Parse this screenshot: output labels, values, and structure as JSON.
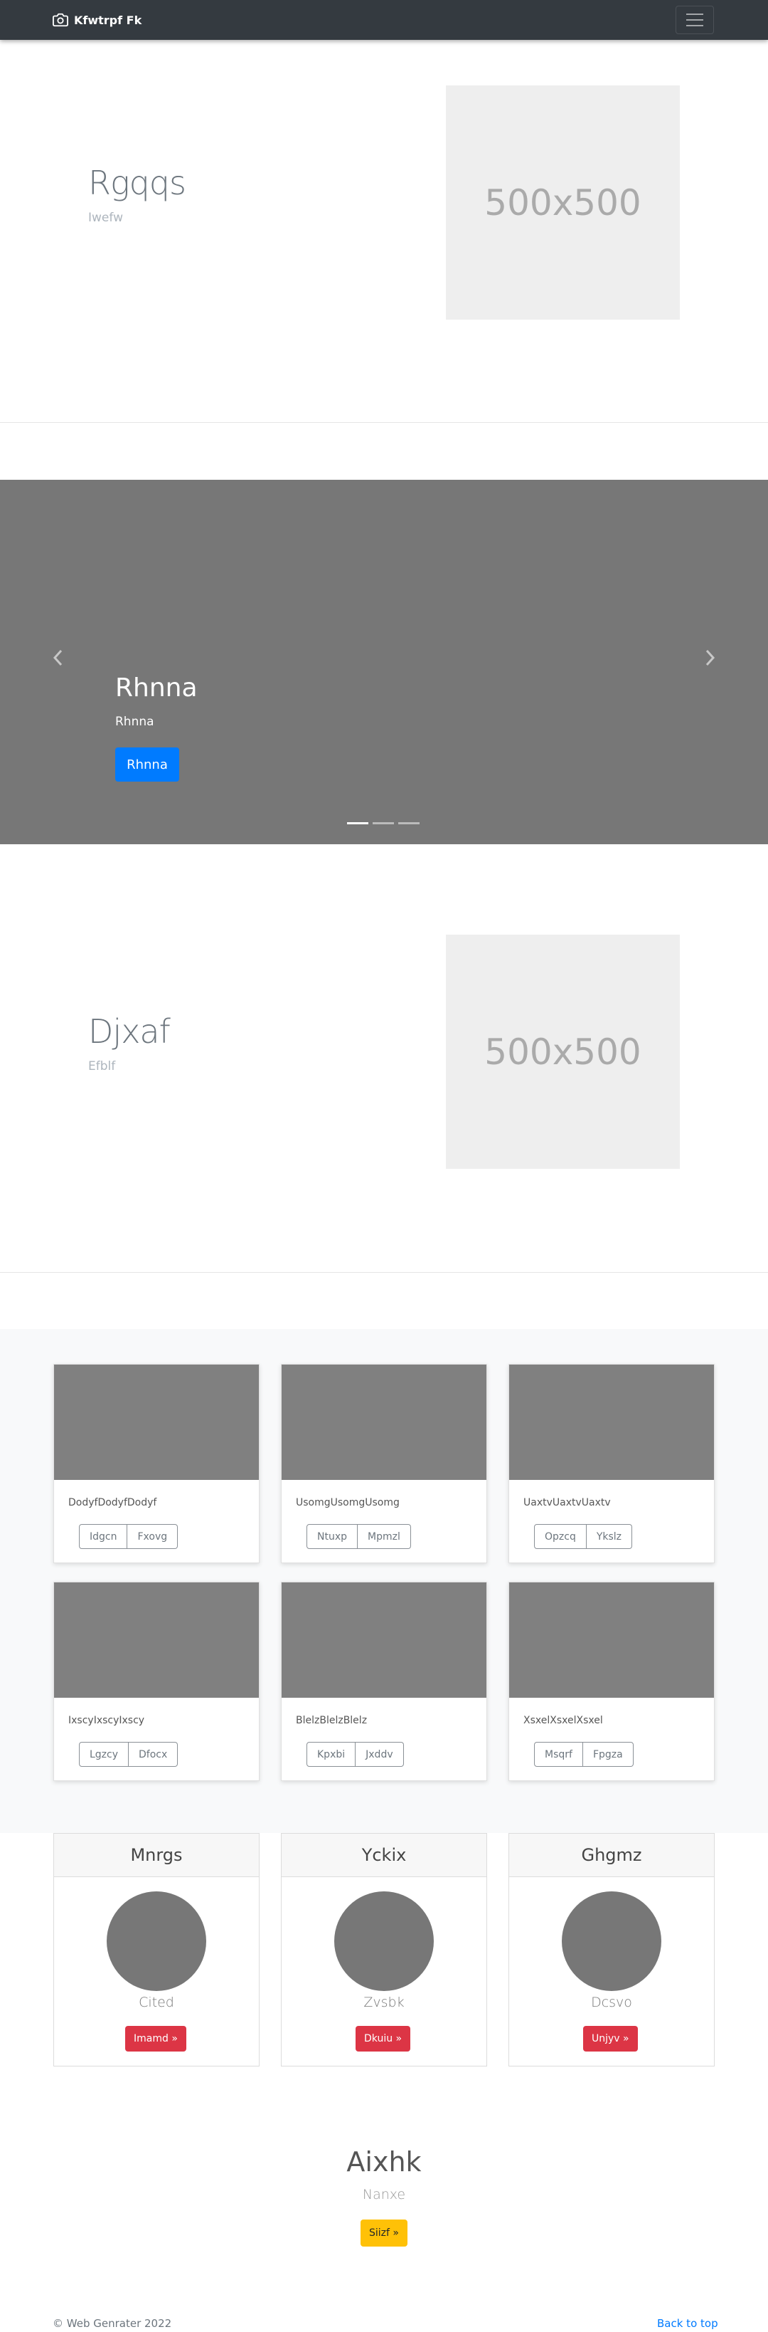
{
  "navbar": {
    "brand": "Kfwtrpf Fk",
    "brand_icon": "camera-icon",
    "toggler_icon": "hamburger-menu-icon"
  },
  "feature1": {
    "heading": "Rgqqs",
    "subheading": "Iwefw",
    "image_text": "500x500"
  },
  "carousel": {
    "title": "Rhnna",
    "text": "Rhnna",
    "button": "Rhnna",
    "prev_icon": "chevron-left-icon",
    "next_icon": "chevron-right-icon",
    "slides": 3,
    "active_slide": 1
  },
  "feature2": {
    "heading": "Djxaf",
    "subheading": "Efblf",
    "image_text": "500x500"
  },
  "cards": [
    {
      "text": "DodyfDodyfDodyf",
      "btn1": "Idgcn",
      "btn2": "Fxovg"
    },
    {
      "text": "UsomgUsomgUsomg",
      "btn1": "Ntuxp",
      "btn2": "Mpmzl"
    },
    {
      "text": "UaxtvUaxtvUaxtv",
      "btn1": "Opzcq",
      "btn2": "Ykslz"
    },
    {
      "text": "IxscyIxscyIxscy",
      "btn1": "Lgzcy",
      "btn2": "Dfocx"
    },
    {
      "text": "BlelzBlelzBlelz",
      "btn1": "Kpxbi",
      "btn2": "Jxddv"
    },
    {
      "text": "XsxelXsxelXsxel",
      "btn1": "Msqrf",
      "btn2": "Fpgza"
    }
  ],
  "profiles": [
    {
      "header": "Mnrgs",
      "name": "Cited",
      "button": "Imamd »"
    },
    {
      "header": "Yckix",
      "name": "Zvsbk",
      "button": "Dkuiu »"
    },
    {
      "header": "Ghgmz",
      "name": "Dcsvo",
      "button": "Unjyv »"
    }
  ],
  "cta": {
    "title": "Aixhk",
    "subtitle": "Nanxe",
    "button": "Siizf »"
  },
  "footer": {
    "copyright": "© Web Genrater 2022",
    "back_to_top": "Back to top"
  },
  "colors": {
    "navbar": "#343a40",
    "primary": "#007bff",
    "danger": "#dc3545",
    "warning": "#ffc107",
    "placeholder": "#808080"
  }
}
